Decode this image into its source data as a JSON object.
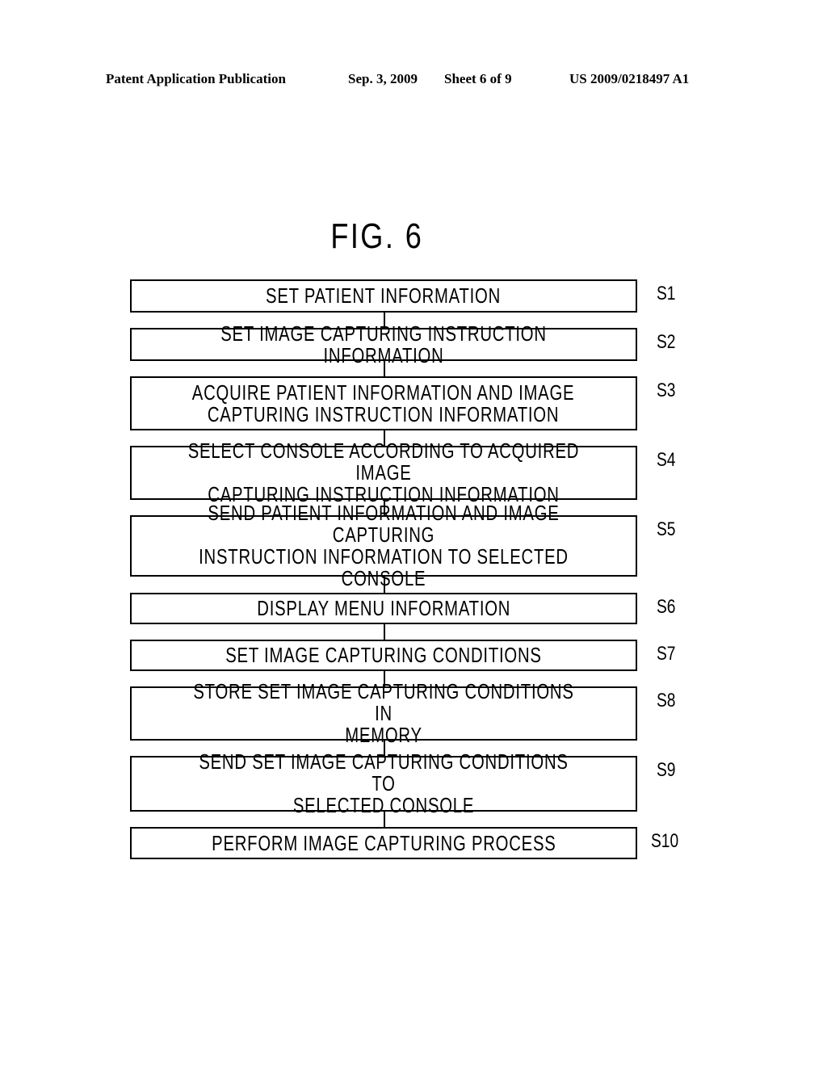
{
  "header": {
    "publication": "Patent Application Publication",
    "date": "Sep. 3, 2009",
    "sheet": "Sheet 6 of 9",
    "number": "US 2009/0218497 A1"
  },
  "figure": {
    "title": "FIG. 6",
    "steps": [
      {
        "id": "S1",
        "text": "SET PATIENT INFORMATION"
      },
      {
        "id": "S2",
        "text": "SET IMAGE CAPTURING INSTRUCTION INFORMATION"
      },
      {
        "id": "S3",
        "text": "ACQUIRE PATIENT INFORMATION AND IMAGE\nCAPTURING INSTRUCTION INFORMATION"
      },
      {
        "id": "S4",
        "text": "SELECT CONSOLE ACCORDING TO ACQUIRED IMAGE\nCAPTURING INSTRUCTION INFORMATION"
      },
      {
        "id": "S5",
        "text": "SEND PATIENT INFORMATION AND IMAGE CAPTURING\nINSTRUCTION INFORMATION TO SELECTED CONSOLE"
      },
      {
        "id": "S6",
        "text": "DISPLAY MENU INFORMATION"
      },
      {
        "id": "S7",
        "text": "SET IMAGE CAPTURING CONDITIONS"
      },
      {
        "id": "S8",
        "text": "STORE SET IMAGE CAPTURING CONDITIONS IN\nMEMORY"
      },
      {
        "id": "S9",
        "text": "SEND SET IMAGE CAPTURING CONDITIONS TO\nSELECTED CONSOLE"
      },
      {
        "id": "S10",
        "text": "PERFORM IMAGE CAPTURING PROCESS"
      }
    ]
  }
}
